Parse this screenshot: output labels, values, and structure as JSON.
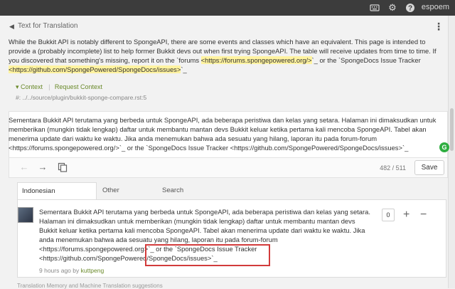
{
  "topbar": {
    "keyboard_icon": "keyboard-icon",
    "settings_icon": "gear-icon",
    "help_icon": "help-icon",
    "username": "espoem"
  },
  "source": {
    "header_title": "Text for Translation",
    "text_before_link1": "While the Bukkit API is notably different to SpongeAPI, there are some events and classes which have an equivalent. This page is intended to provide a (probably incomplete) list to help former Bukkit devs out when first trying SpongeAPI. The table will receive updates from time to time. If you discovered that something's missing, report it on the `forums ",
    "link1": "<https://forums.spongepowered.org/>",
    "text_between": "`_ or the `SpongeDocs Issue Tracker ",
    "link2": "<https://github.com/SpongePowered/SpongeDocs/issues>",
    "text_after": "`_",
    "context_label": "Context",
    "request_context_label": "Request Context",
    "path": "#: ../../source/plugin/bukkit-sponge-compare.rst:5"
  },
  "editor": {
    "text": "Sementara Bukkit API terutama yang berbeda untuk SpongeAPI, ada beberapa peristiwa dan kelas yang setara. Halaman ini dimaksudkan untuk memberikan (mungkin tidak lengkap) daftar untuk membantu mantan devs Bukkit keluar ketika pertama kali mencoba SpongeAPI. Tabel akan menerima update dari waktu ke waktu. Jika anda menemukan bahwa ada sesuatu yang hilang, laporan itu pada forum-forum <https://forums.spongepowered.org/>`_ or the `SpongeDocs Issue Tracker <https://github.com/SpongePowered/SpongeDocs/issues>`_",
    "counter": "482 / 511",
    "save_label": "Save"
  },
  "tabs": [
    {
      "label": "Indonesian Suggestions"
    },
    {
      "label": "Other Languages"
    },
    {
      "label": "Search TM"
    }
  ],
  "suggestion": {
    "text": "Sementara Bukkit API terutama yang berbeda untuk SpongeAPI, ada beberapa peristiwa dan kelas yang setara. Halaman ini dimaksudkan untuk memberikan (mungkin tidak lengkap) daftar untuk membantu mantan devs Bukkit keluar ketika pertama kali mencoba SpongeAPI. Tabel akan menerima update dari waktu ke waktu. Jika anda menemukan bahwa ada sesuatu yang hilang, laporan itu pada forum-forum <https://forums.spongepowered.org>`_ or the `SpongeDocs Issue Tracker <https://github.com/SpongePowered/SpongeDocs/issues>`_",
    "time": "9 hours ago by",
    "author": "kuttpeng",
    "votes": "0"
  },
  "footer_title": "Translation Memory and Machine Translation suggestions"
}
